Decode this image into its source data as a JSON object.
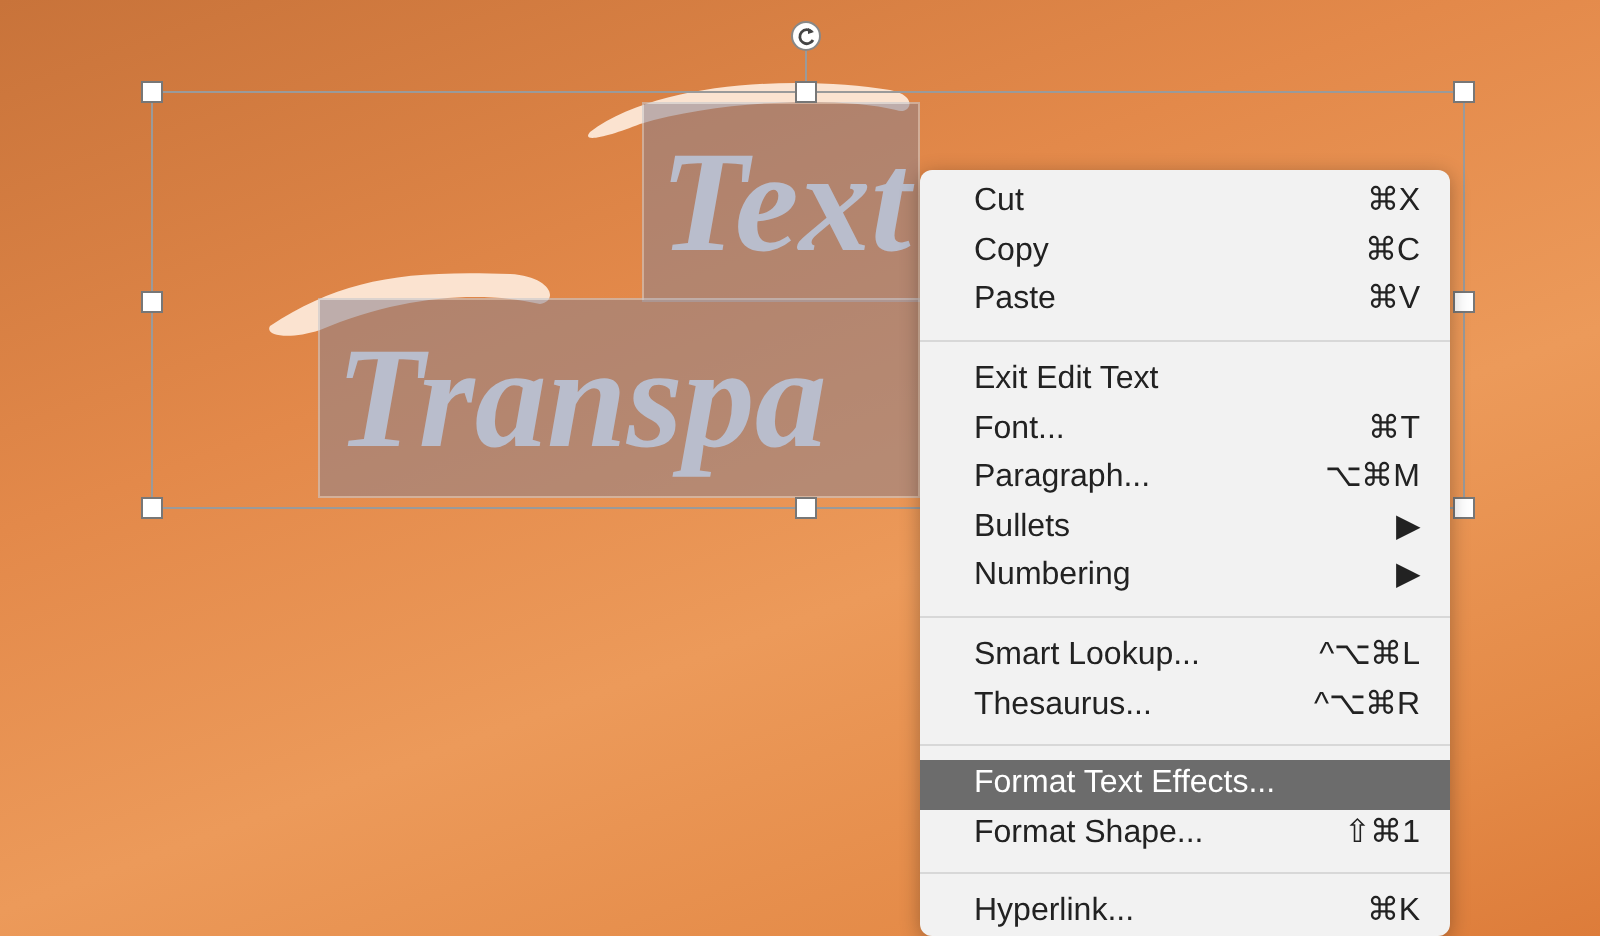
{
  "slide": {
    "text_lines": [
      {
        "text": "Text"
      },
      {
        "text": "Transpa"
      }
    ]
  },
  "context_menu": {
    "sections": [
      [
        {
          "label": "Cut",
          "shortcut": "⌘X",
          "selected": false
        },
        {
          "label": "Copy",
          "shortcut": "⌘C",
          "selected": false
        },
        {
          "label": "Paste",
          "shortcut": "⌘V",
          "selected": false
        }
      ],
      [
        {
          "label": "Exit Edit Text",
          "selected": false
        },
        {
          "label": "Font...",
          "shortcut": "⌘T",
          "selected": false
        },
        {
          "label": "Paragraph...",
          "shortcut": "⌥⌘M",
          "selected": false
        },
        {
          "label": "Bullets",
          "shortcut": "▶",
          "selected": false
        },
        {
          "label": "Numbering",
          "shortcut": "▶",
          "selected": false
        }
      ],
      [
        {
          "label": "Smart Lookup...",
          "shortcut": "^⌥⌘L",
          "selected": false
        },
        {
          "label": "Thesaurus...",
          "shortcut": "^⌥⌘R",
          "selected": false
        }
      ],
      [
        {
          "label": "Format Text Effects...",
          "selected": true
        },
        {
          "label": "Format Shape...",
          "shortcut": "⇧⌘1",
          "selected": false
        }
      ],
      [
        {
          "label": "Hyperlink...",
          "shortcut": "⌘K",
          "selected": false
        }
      ]
    ]
  }
}
